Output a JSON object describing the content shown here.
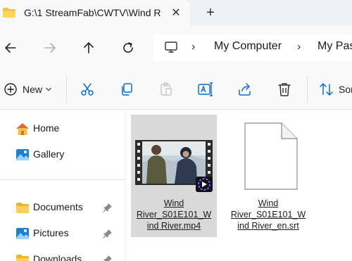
{
  "tab": {
    "title": "G:\\1 StreamFab\\CWTV\\Wind R"
  },
  "address": {
    "items": [
      "My Computer",
      "My Pas"
    ]
  },
  "command_bar": {
    "new_label": "New",
    "sort_label": "Sort"
  },
  "sidebar": {
    "items": [
      {
        "label": "Home",
        "icon": "home-icon"
      },
      {
        "label": "Gallery",
        "icon": "gallery-icon"
      },
      {
        "label": "Documents",
        "icon": "folder-icon",
        "pinned": true
      },
      {
        "label": "Pictures",
        "icon": "pictures-icon",
        "pinned": true
      },
      {
        "label": "Downloads",
        "icon": "folder-icon",
        "pinned": true
      }
    ]
  },
  "files": [
    {
      "line1": "Wind",
      "line2": "River_S01E101_W",
      "line3": "ind River.mp4",
      "type": "video",
      "selected": true
    },
    {
      "line1": "Wind",
      "line2": "River_S01E101_W",
      "line3": "ind River_en.srt",
      "type": "document",
      "selected": false
    }
  ],
  "colors": {
    "folder": "#f6c343",
    "accent": "#0a6cd6",
    "selection": "#d9d9d9"
  }
}
